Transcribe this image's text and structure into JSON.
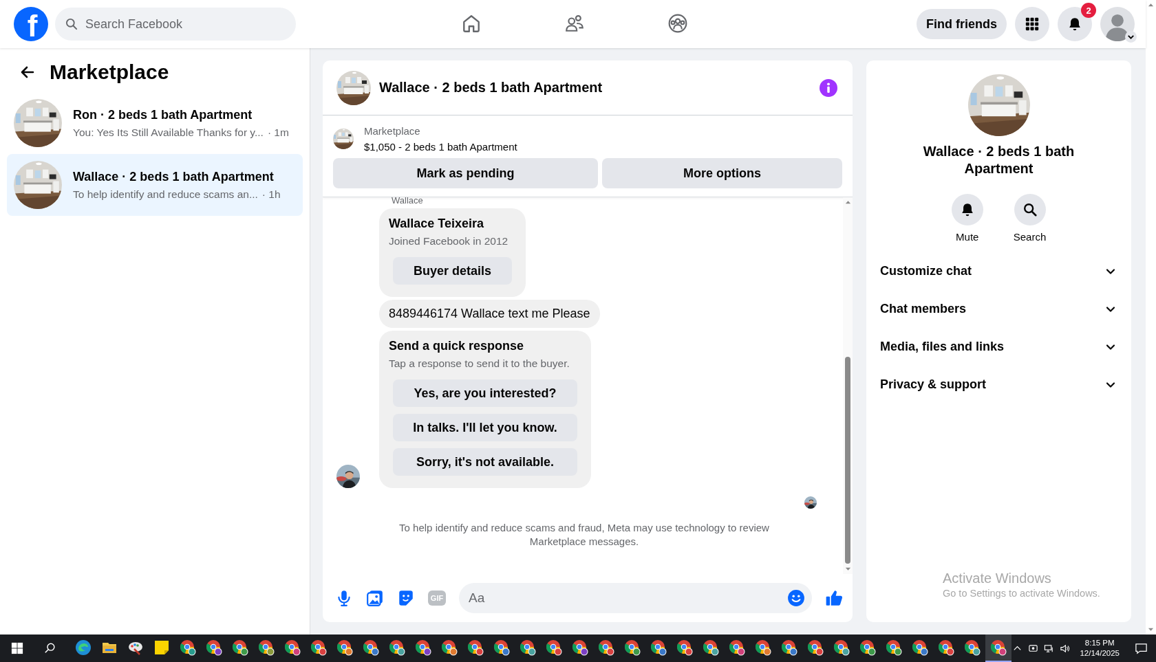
{
  "topbar": {
    "logo": "f",
    "search": {
      "placeholder": "Search Facebook"
    },
    "nav": [
      {
        "kind": "home",
        "selected": false
      },
      {
        "kind": "friends",
        "selected": false
      },
      {
        "kind": "groups",
        "selected": false
      }
    ],
    "find_friends": "Find friends",
    "notifications_badge": "2"
  },
  "sidebar": {
    "title": "Marketplace",
    "items": [
      {
        "title": "Ron · 2 beds 1 bath Apartment",
        "snippet": "You: Yes Its Still Available Thanks for y...",
        "time": "· 1m",
        "selected": false
      },
      {
        "title": "Wallace · 2 beds 1 bath Apartment",
        "snippet": "To help identify and reduce scams an...",
        "time": "· 1h",
        "selected": true
      }
    ]
  },
  "chat": {
    "title": "Wallace · 2 beds 1 bath Apartment",
    "listing": {
      "label": "Marketplace",
      "text": "$1,050 - 2 beds 1 bath Apartment"
    },
    "actions": [
      "Mark as pending",
      "More options"
    ],
    "sender_label": "Wallace",
    "buyer_card": {
      "name": "Wallace Teixeira",
      "joined": "Joined Facebook in 2012",
      "button": "Buyer details"
    },
    "message": "8489446174 Wallace text me Please",
    "quick_response": {
      "title": "Send a quick response",
      "hint": "Tap a response to send it to the buyer.",
      "options": [
        "Yes, are you interested?",
        "In talks. I'll let you know.",
        "Sorry, it's not available."
      ]
    },
    "notice": "To help identify and reduce scams and fraud, Meta may use technology to review Marketplace messages.",
    "composer": {
      "gif_label": "GIF",
      "placeholder": "Aa"
    }
  },
  "details": {
    "title": "Wallace · 2 beds 1 bath Apartment",
    "actions": [
      {
        "kind": "mute",
        "label": "Mute"
      },
      {
        "kind": "search",
        "label": "Search"
      }
    ],
    "sections": [
      {
        "label": "Customize chat",
        "expanded": false
      },
      {
        "label": "Chat members",
        "expanded": false
      },
      {
        "label": "Media, files and links",
        "expanded": false
      },
      {
        "label": "Privacy & support",
        "expanded": false
      }
    ]
  },
  "activation": {
    "title": "Activate Windows",
    "text": "Go to Settings to activate Windows."
  },
  "taskbar": {
    "apps": [
      {
        "kind": "edge",
        "selected": false
      },
      {
        "kind": "folder",
        "selected": false
      },
      {
        "kind": "paint",
        "selected": false
      },
      {
        "kind": "notes",
        "selected": false
      },
      {
        "kind": "chrome",
        "color": "#2a9d8f",
        "selected": false
      },
      {
        "kind": "chrome",
        "color": "#7b3fc4",
        "selected": false
      },
      {
        "kind": "chrome",
        "color": "#3e9a4a",
        "selected": false
      },
      {
        "kind": "chrome",
        "color": "#8a9a3a",
        "selected": false
      },
      {
        "kind": "chrome",
        "color": "#d0407a",
        "selected": false
      },
      {
        "kind": "chrome",
        "color": "#d94040",
        "selected": false
      },
      {
        "kind": "chrome",
        "color": "#e07a30",
        "selected": false
      },
      {
        "kind": "chrome",
        "color": "#3a78c8",
        "selected": false
      },
      {
        "kind": "chrome",
        "color": "#4aa3a0",
        "selected": false
      },
      {
        "kind": "chrome",
        "color": "#7b3fc4",
        "selected": false
      },
      {
        "kind": "chrome",
        "color": "#e07a30",
        "selected": false
      },
      {
        "kind": "chrome",
        "color": "#d94040",
        "selected": false
      },
      {
        "kind": "chrome",
        "color": "#3a78c8",
        "selected": false
      },
      {
        "kind": "chrome",
        "color": "#4aa3a0",
        "selected": false
      },
      {
        "kind": "chrome",
        "color": "#d94040",
        "selected": false
      },
      {
        "kind": "chrome",
        "color": "#7b3fc4",
        "selected": false
      },
      {
        "kind": "chrome",
        "color": "#d94040",
        "selected": false
      },
      {
        "kind": "chrome",
        "color": "#3e9a4a",
        "selected": false
      },
      {
        "kind": "chrome",
        "color": "#3a78c8",
        "selected": false
      },
      {
        "kind": "chrome",
        "color": "#d94040",
        "selected": false
      },
      {
        "kind": "chrome",
        "color": "#4aa3a0",
        "selected": false
      },
      {
        "kind": "chrome",
        "color": "#d0407a",
        "selected": false
      },
      {
        "kind": "chrome",
        "color": "#e07a30",
        "selected": false
      },
      {
        "kind": "chrome",
        "color": "#3a78c8",
        "selected": false
      },
      {
        "kind": "chrome",
        "color": "#d94040",
        "selected": false
      },
      {
        "kind": "chrome",
        "color": "#4aa3a0",
        "selected": false
      },
      {
        "kind": "chrome",
        "color": "#3e9a4a",
        "selected": false
      },
      {
        "kind": "chrome",
        "color": "#3e9a4a",
        "selected": false
      },
      {
        "kind": "chrome",
        "color": "#3a78c8",
        "selected": false
      },
      {
        "kind": "chrome",
        "color": "#d94040",
        "selected": false
      },
      {
        "kind": "chrome",
        "color": "#4aa3a0",
        "selected": false
      },
      {
        "kind": "chrome",
        "color": "#d0407a",
        "selected": true
      }
    ],
    "time": "8:15 PM",
    "date": "12/14/2025"
  }
}
